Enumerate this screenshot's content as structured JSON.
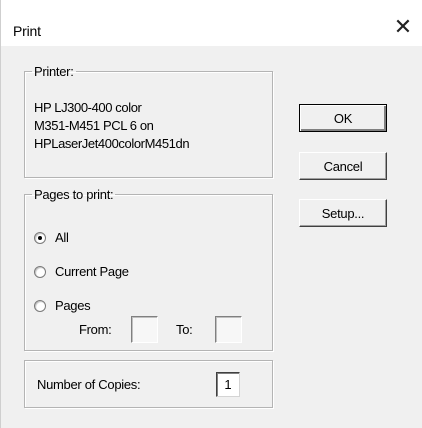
{
  "window": {
    "title": "Print",
    "close_glyph": "✕"
  },
  "printer": {
    "legend": "Printer:",
    "lines": [
      "HP LJ300-400 color",
      "M351-M451 PCL 6 on",
      "HPLaserJet400colorM451dn"
    ]
  },
  "pages": {
    "legend": "Pages to print:",
    "options": [
      {
        "label": "All",
        "checked": true
      },
      {
        "label": "Current Page",
        "checked": false
      },
      {
        "label": "Pages",
        "checked": false
      }
    ],
    "from_label": "From:",
    "to_label": "To:",
    "from_value": "",
    "to_value": ""
  },
  "copies": {
    "label": "Number of Copies:",
    "value": "1"
  },
  "buttons": {
    "ok": "OK",
    "cancel": "Cancel",
    "setup": "Setup..."
  },
  "icons": {
    "close": "close-icon",
    "radio": "radio-button"
  }
}
